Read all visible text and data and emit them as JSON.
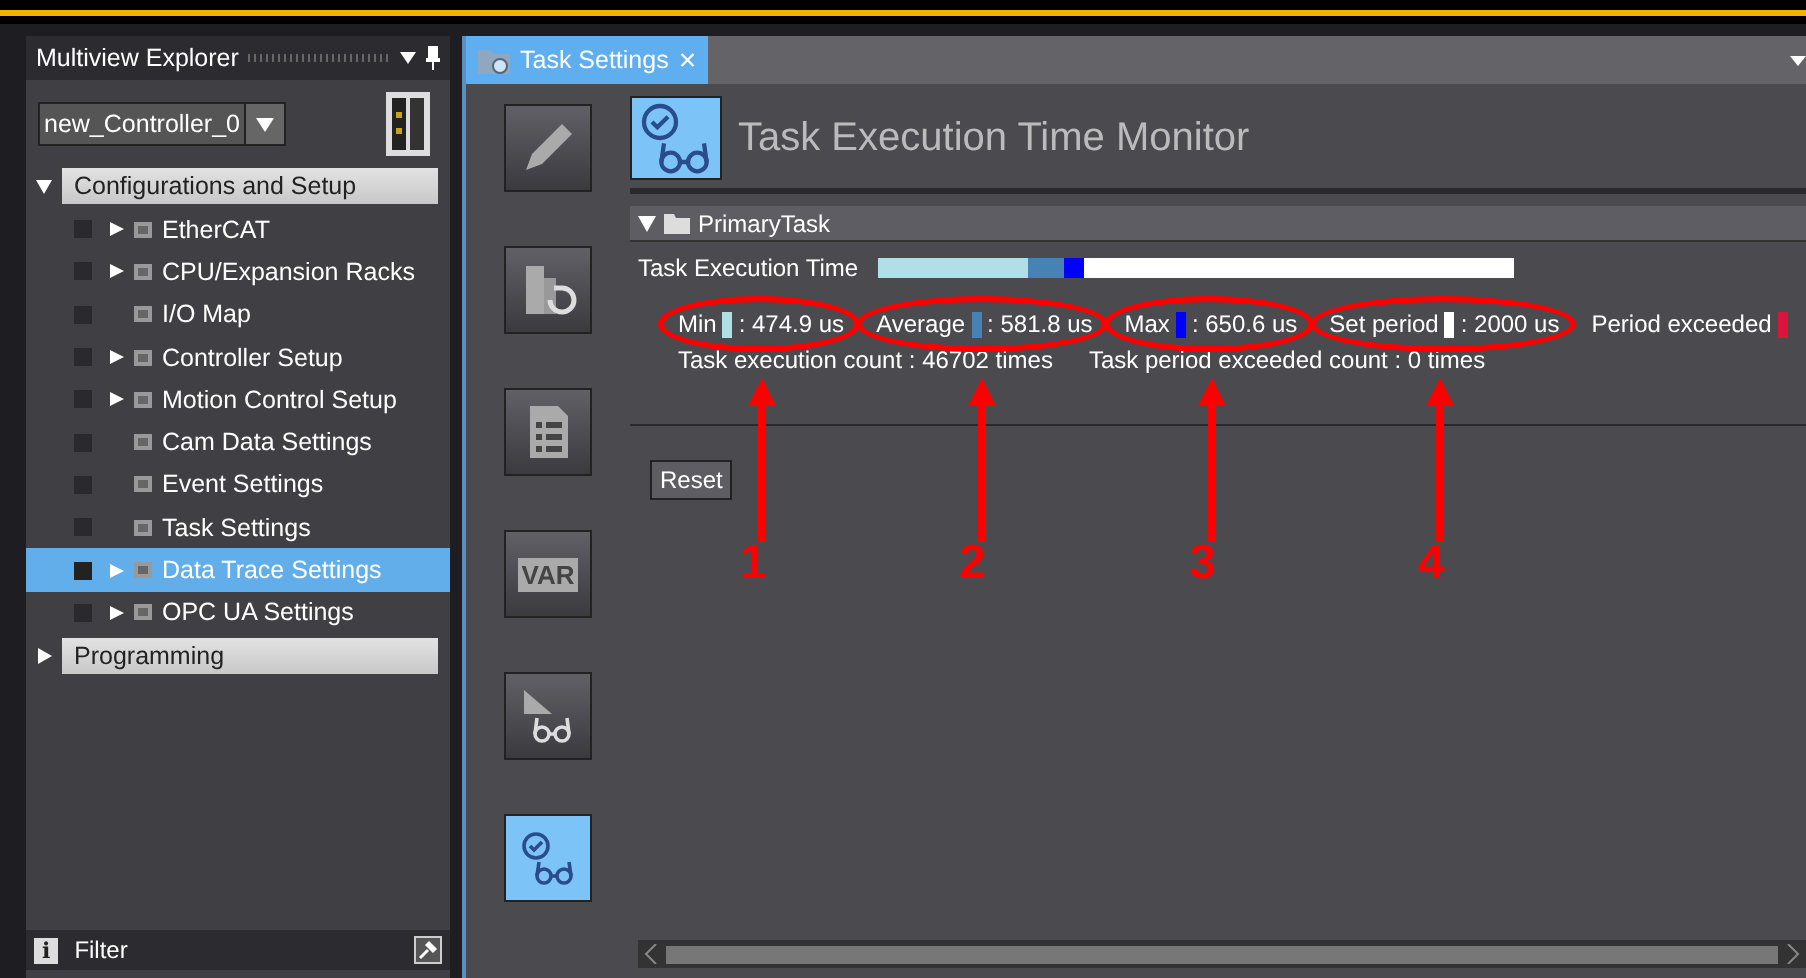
{
  "explorer": {
    "title": "Multiview Explorer",
    "controller": "new_Controller_0",
    "tree": [
      {
        "label": "Configurations and Setup",
        "expanded": true,
        "children": [
          {
            "label": "EtherCAT",
            "expanded": false,
            "selected": false
          },
          {
            "label": "CPU/Expansion Racks",
            "expanded": false,
            "selected": false
          },
          {
            "label": "I/O Map",
            "selected": false
          },
          {
            "label": "Controller Setup",
            "expanded": false,
            "selected": false
          },
          {
            "label": "Motion Control Setup",
            "expanded": false,
            "selected": false
          },
          {
            "label": "Cam Data Settings",
            "selected": false
          },
          {
            "label": "Event Settings",
            "selected": false
          },
          {
            "label": "Task Settings",
            "selected": false
          },
          {
            "label": "Data Trace Settings",
            "expanded": false,
            "selected": true
          },
          {
            "label": "OPC UA Settings",
            "expanded": false,
            "selected": false
          }
        ]
      },
      {
        "label": "Programming",
        "expanded": false
      }
    ],
    "filter": {
      "icon": "i",
      "label": "Filter"
    }
  },
  "tab": {
    "label": "Task Settings",
    "close": "×",
    "selected": true
  },
  "tools": [
    {
      "kind": "pencil",
      "selected": false
    },
    {
      "kind": "revert",
      "selected": false
    },
    {
      "kind": "list",
      "selected": false
    },
    {
      "kind": "var",
      "label": "VAR",
      "selected": false
    },
    {
      "kind": "watch",
      "selected": false
    },
    {
      "kind": "monitor",
      "selected": true
    }
  ],
  "monitor": {
    "title": "Task Execution Time Monitor",
    "task": "PrimaryTask",
    "expanded": true,
    "bar_label": "Task Execution Time",
    "track": {
      "color": "#ffffff"
    },
    "segments": [
      {
        "level": 0.237
      },
      {
        "level": 0.291
      },
      {
        "level": 0.325
      }
    ],
    "stats": [
      {
        "label": "Min",
        "color": "#b0e0e6",
        "value": ": 474.9 us",
        "callout": "1"
      },
      {
        "label": "Average",
        "color": "#4682b4",
        "value": ": 581.8 us",
        "callout": "2"
      },
      {
        "label": "Max",
        "color": "#0000ff",
        "value": ": 650.6 us",
        "callout": "3"
      },
      {
        "label": "Set period",
        "color": "#ffffff",
        "value": ": 2000 us",
        "callout": "4"
      },
      {
        "label": "Period exceeded",
        "color": "#dc143c"
      }
    ],
    "counts": [
      "Task execution count : 46702 times",
      "Task period exceeded count : 0 times"
    ],
    "reset": "Reset"
  }
}
